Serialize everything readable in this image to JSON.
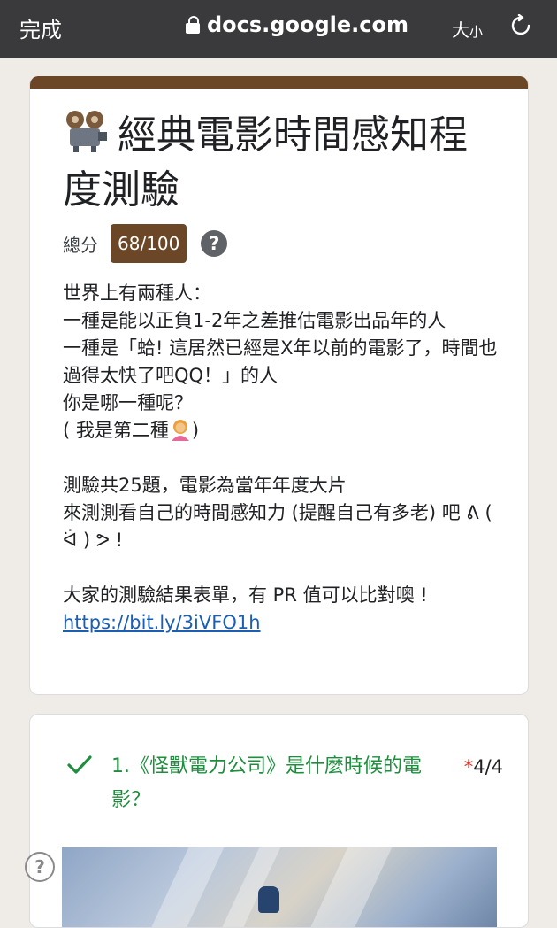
{
  "browser": {
    "done_label": "完成",
    "url": "docs.google.com",
    "text_size_big": "大",
    "text_size_small": "小"
  },
  "form": {
    "title": "經典電影時間感知程度測驗",
    "score_label": "總分",
    "score_value": "68/100",
    "description": {
      "line1": "世界上有兩種人：",
      "line2": "一種是能以正負1-2年之差推估電影出品年的人",
      "line3": "一種是「蛤! 這居然已經是X年以前的電影了，時間也過得太快了吧QQ！」的人",
      "line4": "你是哪一種呢？",
      "line5": "( 我是第二種",
      "line5_end": ")",
      "line6": "測驗共25題，電影為當年年度大片",
      "line7": "來測測看自己的時間感知力 (提醒自己有多老) 吧 ᕕ ( ᐛ ) ᕗ !",
      "line8": "大家的測驗結果表單，有 PR 值可以比對噢 !",
      "link": "https://bit.ly/3iVFO1h"
    }
  },
  "question1": {
    "text": "1.《怪獸電力公司》是什麼時候的電影？",
    "required_mark": "*",
    "score": "4/4"
  },
  "help_glyph": "?",
  "colors": {
    "header_band": "#6b4627",
    "correct_green": "#1e8e3e",
    "required_red": "#d93025",
    "link_blue": "#1a5fb4"
  }
}
